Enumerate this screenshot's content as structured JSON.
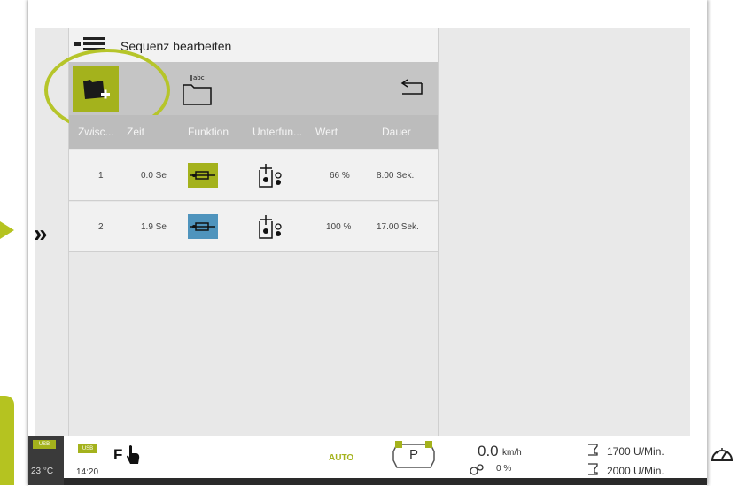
{
  "header": {
    "title": "Sequenz bearbeiten"
  },
  "toolbar": {
    "rename_icon_text": "abc"
  },
  "table": {
    "columns": [
      "Zwisc...",
      "Zeit",
      "Funktion",
      "Unterfun...",
      "Wert",
      "Dauer"
    ],
    "rows": [
      {
        "index": "1",
        "time": "0.0 Se",
        "function_color": "#a4b21c",
        "value": "66 %",
        "duration": "8.00 Sek."
      },
      {
        "index": "2",
        "time": "1.9 Se",
        "function_color": "#4f94bd",
        "value": "100 %",
        "duration": "17.00 Sek."
      }
    ]
  },
  "sidebar": {
    "expand_icon": "double-chevron-right"
  },
  "status_bar": {
    "temperature": "23 °C",
    "time": "14:20",
    "usb_label": "USB",
    "f_label": "F",
    "auto_label": "AUTO",
    "park_label": "P",
    "speed_value": "0.0",
    "speed_unit": "km/h",
    "slip_value": "0 %",
    "rpm_1": "1700 U/Min.",
    "rpm_2": "2000 U/Min."
  },
  "colors": {
    "accent": "#a4b21c",
    "function_blue": "#4f94bd",
    "toolbar_gray": "#c5c5c5"
  }
}
